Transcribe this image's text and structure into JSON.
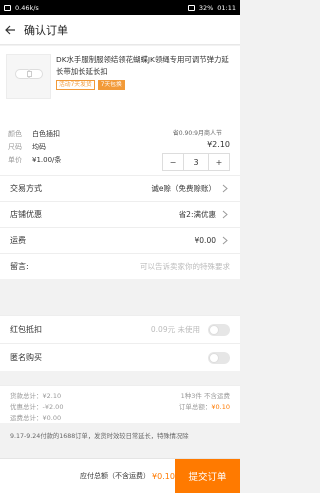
{
  "status_bar": {
    "speed": "0.46k/s",
    "battery": "32%",
    "time": "01:11"
  },
  "header": {
    "title": "确认订单"
  },
  "product": {
    "title": "DK水手服制服领结领花蝴蝶JK领绳专用可调节弹力延长带加长延长扣",
    "badges": [
      "活动7天发货",
      "7天包换"
    ],
    "props": [
      {
        "key": "颜色",
        "value": "白色插扣"
      },
      {
        "key": "尺码",
        "value": "均码"
      },
      {
        "key": "单价",
        "value": "¥1.00/条"
      }
    ],
    "save_text": "省0.90:9月商人节",
    "price": "¥2.10",
    "quantity": "3",
    "minus": "−",
    "plus": "+"
  },
  "rows": [
    {
      "label": "交易方式",
      "value": "诚e赊（免费赊账）",
      "placeholder": false,
      "chevron": true
    },
    {
      "label": "店铺优惠",
      "value": "省2:满优惠",
      "placeholder": false,
      "chevron": true
    },
    {
      "label": "运费",
      "value": "¥0.00",
      "placeholder": false,
      "chevron": true
    },
    {
      "label": "留言:",
      "value": "可以告诉卖家你的特殊要求",
      "placeholder": true,
      "chevron": false
    }
  ],
  "toggles": [
    {
      "label": "红包抵扣",
      "value": "0.09元 未使用",
      "state": "off"
    },
    {
      "label": "匿名购买",
      "value": "",
      "state": "off"
    }
  ],
  "summary": {
    "goods_total": "货款总计：¥2.10",
    "shipping_total": "运费总计：¥0.00",
    "discount_total": "优惠总计：-¥2.00",
    "items_count": "1种3件 不含运费",
    "order_total_label": "订单总额：",
    "order_total_value": "¥0.10"
  },
  "notice": "9.17-9.24付款的1688订单，发货时效较日常延长，特殊情况除",
  "footer": {
    "total_label": "应付总额（不含运费）",
    "total_value": "¥0.10",
    "submit": "提交订单"
  },
  "colors": {
    "accent": "#ff7a00",
    "badge": "#f29a38"
  }
}
